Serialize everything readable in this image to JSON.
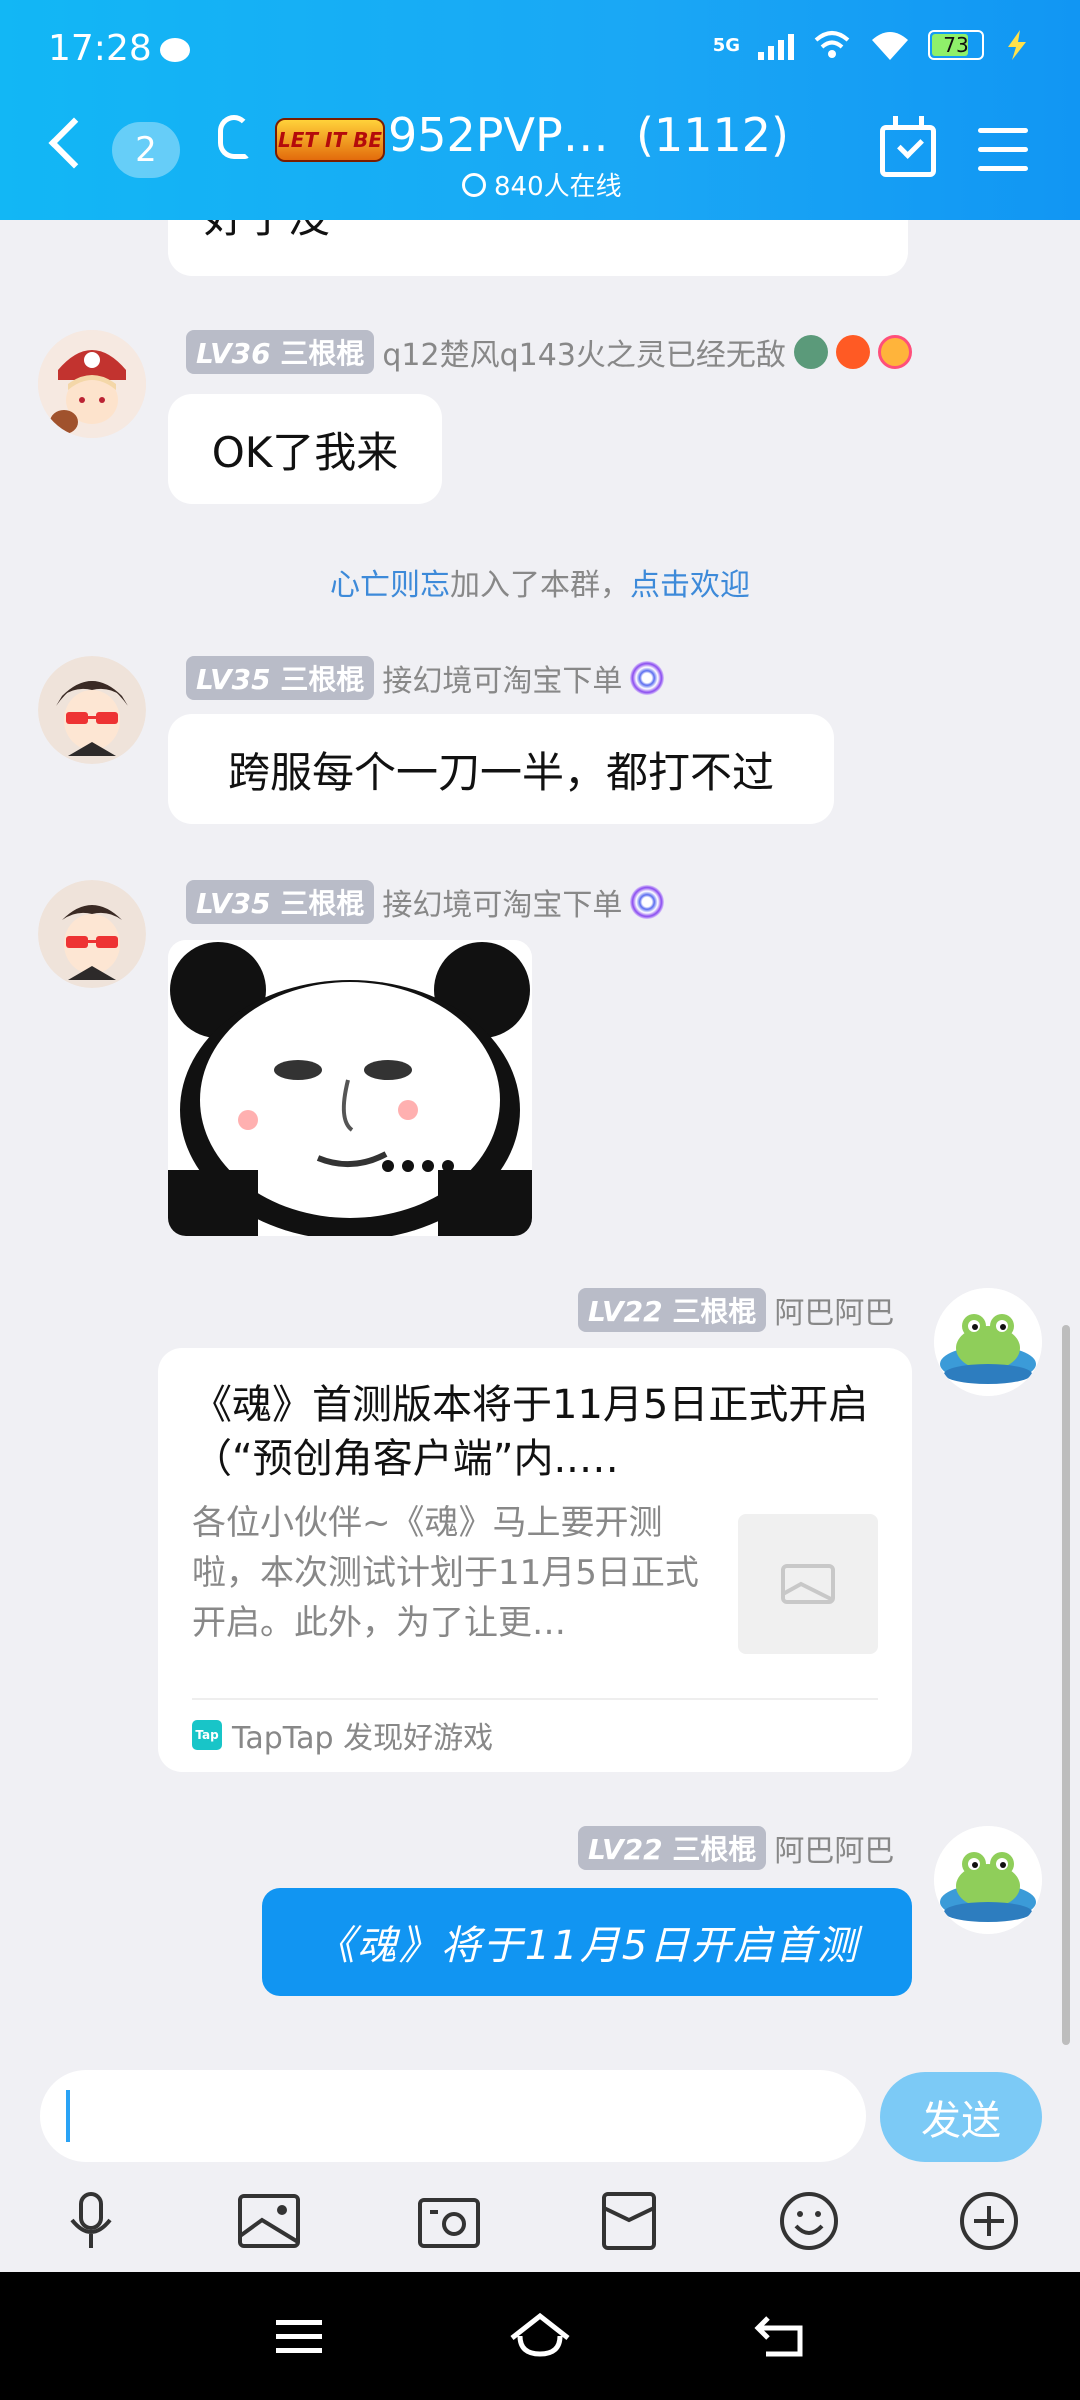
{
  "status": {
    "time": "17:28",
    "network": "5G",
    "battery": "73"
  },
  "header": {
    "unread_count": "2",
    "group_logo_text": "LET IT BE",
    "group_name": "952PVP…",
    "member_count": "(1112)",
    "online_text": "840人在线"
  },
  "messages": {
    "m0": {
      "text": "好了没"
    },
    "m1": {
      "level": "LV36",
      "title": "三根棍",
      "sender": "q12楚风q143火之灵已经无敌",
      "text": "OK了我来"
    },
    "system": {
      "name": "心亡则忘",
      "middle": "加入了本群，",
      "action": "点击欢迎"
    },
    "m2": {
      "level": "LV35",
      "title": "三根棍",
      "sender": "接幻境可淘宝下单",
      "text": "跨服每个一刀一半，都打不过"
    },
    "m3": {
      "level": "LV35",
      "title": "三根棍",
      "sender": "接幻境可淘宝下单"
    },
    "m4": {
      "level": "LV22",
      "title": "三根棍",
      "sender": "阿巴阿巴",
      "card_title": "《魂》首测版本将于11月5日正式开启（“预创角客户端”内..…",
      "card_desc": "各位小伙伴~《魂》马上要开测啦，本次测试计划于11月5日正式开启。此外，为了让更…",
      "card_source": "TapTap 发现好游戏",
      "source_logo": "Tap"
    },
    "m5": {
      "level": "LV22",
      "title": "三根棍",
      "sender": "阿巴阿巴",
      "text": "《魂》将于11月5日开启首测"
    }
  },
  "input": {
    "placeholder": "",
    "send_label": "发送"
  },
  "colors": {
    "header": "#12b7f5",
    "bubble_blue": "#1195f2",
    "link": "#3d8ad9"
  },
  "toolbar_icons": [
    "microphone-icon",
    "image-icon",
    "camera-icon",
    "red-packet-icon",
    "emoji-icon",
    "plus-icon"
  ],
  "nav_icons": [
    "menu-icon",
    "home-icon",
    "back-icon"
  ]
}
